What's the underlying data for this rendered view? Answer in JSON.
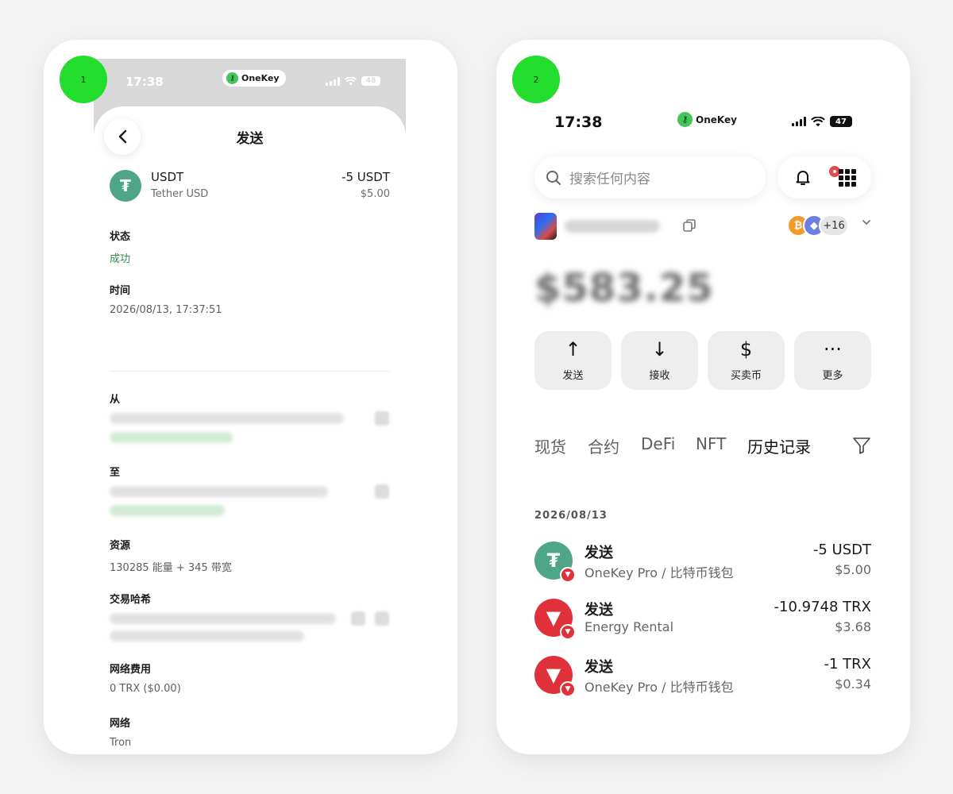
{
  "steps": {
    "one": "1",
    "two": "2"
  },
  "brand": {
    "name": "OneKey",
    "logo_glyph": "⚷",
    "accent": "#44c45a"
  },
  "screen1": {
    "status": {
      "time": "17:38",
      "battery": "48"
    },
    "title": "发送",
    "asset": {
      "symbol": "USDT",
      "name": "Tether USD",
      "amount": "-5 USDT",
      "usd": "$5.00",
      "coin_glyph": "₮"
    },
    "fields": {
      "status_label": "状态",
      "status_value": "成功",
      "time_label": "时间",
      "time_value": "2026/08/13, 17:37:51",
      "from_label": "从",
      "to_label": "至",
      "resource_label": "资源",
      "resource_value": "130285 能量 + 345 带宽",
      "hash_label": "交易哈希",
      "fee_label": "网络费用",
      "fee_value": "0 TRX ($0.00)",
      "network_label": "网络",
      "network_value": "Tron"
    }
  },
  "screen2": {
    "status": {
      "time": "17:38",
      "battery": "47"
    },
    "search_placeholder": "搜索任何内容",
    "chains_more": "+16",
    "balance": "$583.25",
    "actions": [
      {
        "label": "发送",
        "icon": "arrow-up-icon",
        "glyph": "↑"
      },
      {
        "label": "接收",
        "icon": "arrow-down-icon",
        "glyph": "↓"
      },
      {
        "label": "买卖币",
        "icon": "dollar-icon",
        "glyph": "$"
      },
      {
        "label": "更多",
        "icon": "more-icon",
        "glyph": "···"
      }
    ],
    "tabs": [
      "现货",
      "合约",
      "DeFi",
      "NFT",
      "历史记录"
    ],
    "active_tab": "历史记录",
    "date": "2026/08/13",
    "transactions": [
      {
        "title": "发送",
        "sub": "OneKey Pro / 比特币钱包",
        "amount": "-5 USDT",
        "usd": "$5.00",
        "coin": "USDT",
        "glyph": "₮"
      },
      {
        "title": "发送",
        "sub": "Energy Rental",
        "amount": "-10.9748 TRX",
        "usd": "$3.68",
        "coin": "TRX",
        "glyph": "▼"
      },
      {
        "title": "发送",
        "sub": "OneKey Pro / 比特币钱包",
        "amount": "-1 TRX",
        "usd": "$0.34",
        "coin": "TRX",
        "glyph": "▼"
      }
    ]
  },
  "colors": {
    "success": "#2f8a4e",
    "usdt": "#4ea587",
    "trx": "#e0303a",
    "badge": "#22dd2c"
  }
}
